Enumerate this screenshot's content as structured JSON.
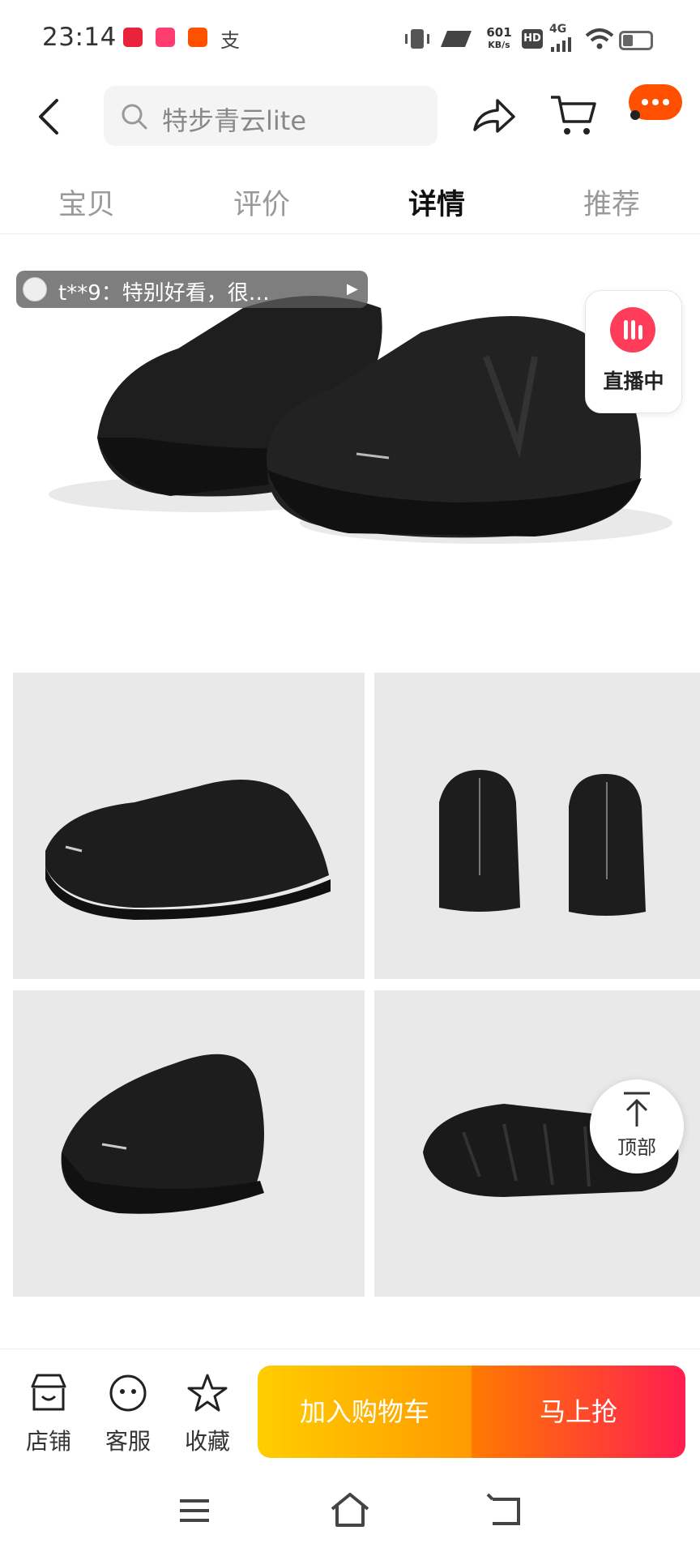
{
  "status_bar": {
    "time": "23:14",
    "app_icon_label": "支",
    "net_rate": "601",
    "net_unit": "KB/s",
    "network": "4G",
    "hd": "HD"
  },
  "header": {
    "search_text": "特步青云lite"
  },
  "tabs": [
    {
      "label": "宝贝",
      "active": false
    },
    {
      "label": "评价",
      "active": false
    },
    {
      "label": "详情",
      "active": true
    },
    {
      "label": "推荐",
      "active": false
    }
  ],
  "barrage": {
    "text": "t**9：特别好看，很…"
  },
  "live": {
    "label": "直播中"
  },
  "back_to_top": {
    "label": "顶部"
  },
  "bottom_bar": {
    "shop": "店铺",
    "service": "客服",
    "favorite": "收藏",
    "add_to_cart": "加入购物车",
    "buy_now": "马上抢"
  },
  "colors": {
    "accent": "#ff5000",
    "live": "#ff3c5a",
    "cart_gradient": [
      "#ffcd00",
      "#ff9a00"
    ],
    "buy_gradient": [
      "#ff7a00",
      "#ff1e50"
    ]
  }
}
